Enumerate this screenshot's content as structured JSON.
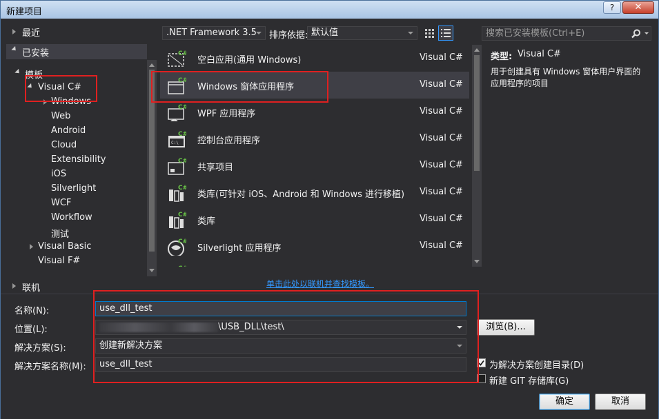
{
  "window": {
    "title": "新建项目",
    "help": "?",
    "close": "✕"
  },
  "left_nav": {
    "recent": "最近",
    "installed": "已安装",
    "templates": "模板",
    "items": [
      "Visual C#",
      "Windows",
      "Web",
      "Android",
      "Cloud",
      "Extensibility",
      "iOS",
      "Silverlight",
      "WCF",
      "Workflow",
      "测试",
      "Visual Basic",
      "Visual F#"
    ],
    "online": "联机"
  },
  "toolbar": {
    "framework": ".NET Framework 3.5",
    "sort_label": "排序依据:",
    "sort_value": "默认值",
    "search_placeholder": "搜索已安装模板(Ctrl+E)"
  },
  "templates": [
    {
      "name": "空白应用(通用 Windows)",
      "lang": "Visual C#",
      "icon": "blank-app-icon"
    },
    {
      "name": "Windows 窗体应用程序",
      "lang": "Visual C#",
      "icon": "windows-forms-icon"
    },
    {
      "name": "WPF 应用程序",
      "lang": "Visual C#",
      "icon": "wpf-app-icon"
    },
    {
      "name": "控制台应用程序",
      "lang": "Visual C#",
      "icon": "console-app-icon"
    },
    {
      "name": "共享项目",
      "lang": "Visual C#",
      "icon": "shared-project-icon"
    },
    {
      "name": "类库(可针对 iOS、Android 和 Windows 进行移植)",
      "lang": "Visual C#",
      "icon": "portable-library-icon"
    },
    {
      "name": "类库",
      "lang": "Visual C#",
      "icon": "class-library-icon"
    },
    {
      "name": "Silverlight 应用程序",
      "lang": "Visual C#",
      "icon": "silverlight-app-icon"
    }
  ],
  "details": {
    "type_label": "类型:",
    "type_value": "Visual C#",
    "description": "用于创建具有 Windows 窗体用户界面的应用程序的项目"
  },
  "online_link": "单击此处以联机并查找模板。",
  "form": {
    "name_label": "名称(N):",
    "name_value": "use_dll_test",
    "location_label": "位置(L):",
    "location_value": "\\USB_DLL\\test\\",
    "solution_label": "解决方案(S):",
    "solution_value": "创建新解决方案",
    "solution_name_label": "解决方案名称(M):",
    "solution_name_value": "use_dll_test",
    "browse": "浏览(B)...",
    "create_dir_label": "为解决方案创建目录(D)",
    "create_dir_checked": true,
    "git_label": "新建 GIT 存储库(G)",
    "git_checked": false,
    "ok": "确定",
    "cancel": "取消"
  }
}
